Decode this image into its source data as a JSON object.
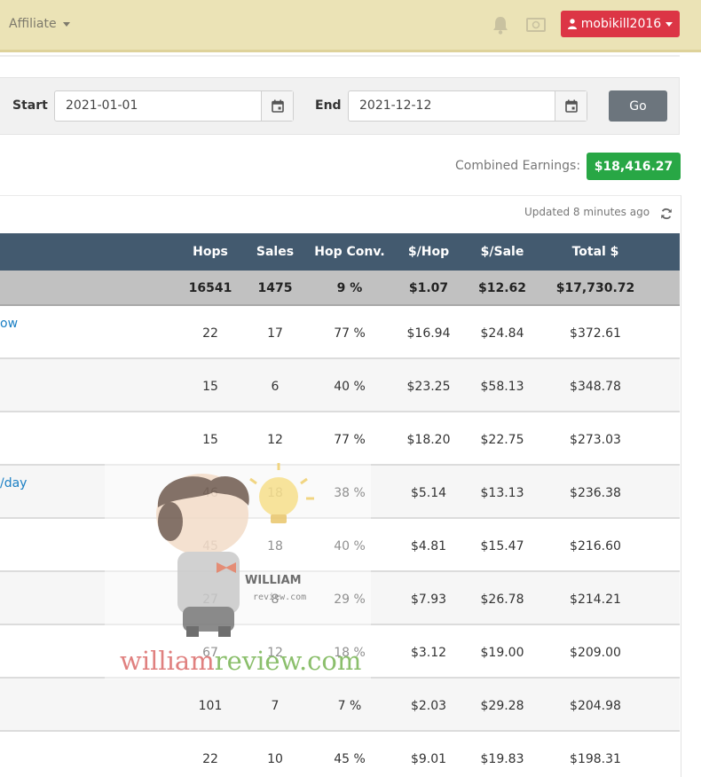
{
  "topbar": {
    "affiliate_label": "Affiliate",
    "user_label": "mobikill2016"
  },
  "filter": {
    "start_label": "Start",
    "start_value": "2021-01-01",
    "end_label": "End",
    "end_value": "2021-12-12",
    "go_label": "Go"
  },
  "earnings": {
    "label": "Combined Earnings:",
    "value": "$18,416.27"
  },
  "card": {
    "updated": "Updated 8 minutes ago"
  },
  "table": {
    "headers": {
      "hops": "Hops",
      "sales": "Sales",
      "hop_conv": "Hop Conv.",
      "per_hop": "$/Hop",
      "per_sale": "$/Sale",
      "total": "Total $"
    },
    "totals": {
      "hops": "16541",
      "sales": "1475",
      "hop_conv": "9 %",
      "per_hop": "$1.07",
      "per_sale": "$12.62",
      "total": "$17,730.72"
    },
    "rows": [
      {
        "name": "ow",
        "hops": "22",
        "sales": "17",
        "hop_conv": "77 %",
        "per_hop": "$16.94",
        "per_sale": "$24.84",
        "total": "$372.61"
      },
      {
        "name": "",
        "hops": "15",
        "sales": "6",
        "hop_conv": "40 %",
        "per_hop": "$23.25",
        "per_sale": "$58.13",
        "total": "$348.78"
      },
      {
        "name": "",
        "hops": "15",
        "sales": "12",
        "hop_conv": "77 %",
        "per_hop": "$18.20",
        "per_sale": "$22.75",
        "total": "$273.03"
      },
      {
        "name": "/day",
        "hops": "46",
        "sales": "18",
        "hop_conv": "38 %",
        "per_hop": "$5.14",
        "per_sale": "$13.13",
        "total": "$236.38"
      },
      {
        "name": "",
        "hops": "45",
        "sales": "18",
        "hop_conv": "40 %",
        "per_hop": "$4.81",
        "per_sale": "$15.47",
        "total": "$216.60"
      },
      {
        "name": "",
        "hops": "27",
        "sales": "8",
        "hop_conv": "29 %",
        "per_hop": "$7.93",
        "per_sale": "$26.78",
        "total": "$214.21"
      },
      {
        "name": "",
        "hops": "67",
        "sales": "12",
        "hop_conv": "18 %",
        "per_hop": "$3.12",
        "per_sale": "$19.00",
        "total": "$209.00"
      },
      {
        "name": "",
        "hops": "101",
        "sales": "7",
        "hop_conv": "7 %",
        "per_hop": "$2.03",
        "per_sale": "$29.28",
        "total": "$204.98"
      },
      {
        "name": "",
        "hops": "22",
        "sales": "10",
        "hop_conv": "45 %",
        "per_hop": "$9.01",
        "per_sale": "$19.83",
        "total": "$198.31"
      }
    ]
  },
  "watermark": {
    "brand": "WILLIAM",
    "sub": "review.com",
    "domain_part1": "william",
    "domain_part2": "review.com"
  },
  "colors": {
    "topbar": "#ebe3b6",
    "user_button": "#dc3545",
    "go_button": "#6c757d",
    "earnings_badge": "#28a745",
    "table_header": "#435a6f",
    "link": "#1a7fc4"
  },
  "icons": [
    "caret-down-icon",
    "bell-icon",
    "money-icon",
    "user-icon",
    "calendar-icon",
    "refresh-icon"
  ]
}
